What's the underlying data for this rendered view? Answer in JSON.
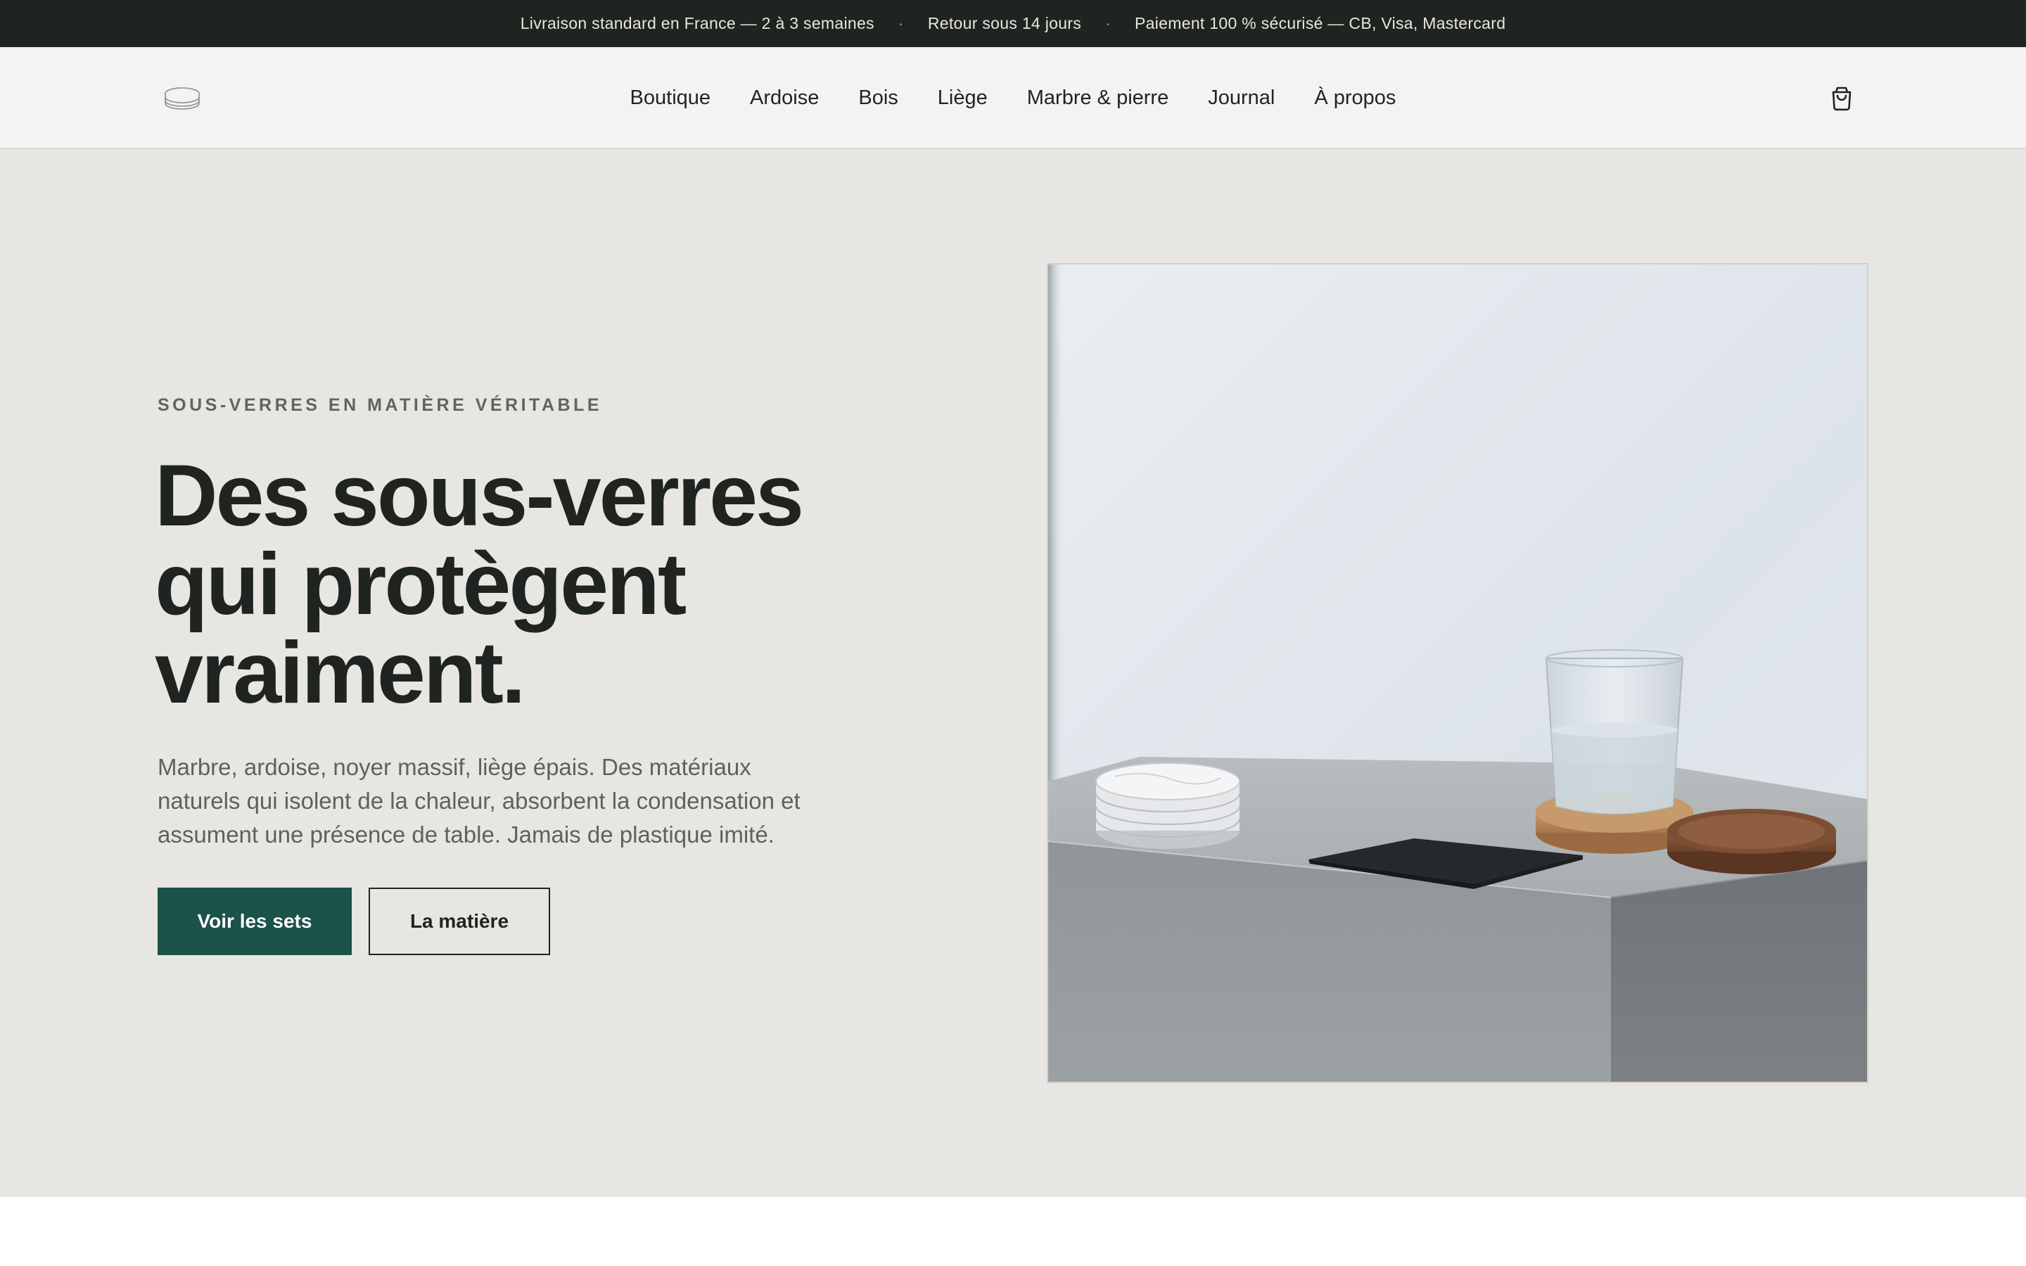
{
  "announcement": {
    "items": [
      "Livraison standard en France — 2 à 3 semaines",
      "Retour sous 14 jours",
      "Paiement 100 % sécurisé — CB, Visa, Mastercard"
    ],
    "separator": "·"
  },
  "header": {
    "logo_icon": "coaster-stack-icon",
    "nav": [
      "Boutique",
      "Ardoise",
      "Bois",
      "Liège",
      "Marbre & pierre",
      "Journal",
      "À propos"
    ],
    "cart_icon": "shopping-bag-icon"
  },
  "hero": {
    "eyebrow": "SOUS-VERRES EN MATIÈRE VÉRITABLE",
    "headline_lines": [
      "Des sous-verres",
      "qui protègent",
      "vraiment."
    ],
    "lede": "Marbre, ardoise, noyer massif, liège épais. Des matériaux naturels qui isolent de la chaleur, absorbent la condensation et assument une présence de table. Jamais de plastique imité.",
    "primary_cta": "Voir les sets",
    "secondary_cta": "La matière"
  },
  "colors": {
    "announcement_bg": "#1f2420",
    "header_bg": "#f3f3f1",
    "hero_bg": "#e7e6e2",
    "accent": "#1b5249",
    "text": "#1f2420",
    "muted": "#5b635f"
  }
}
